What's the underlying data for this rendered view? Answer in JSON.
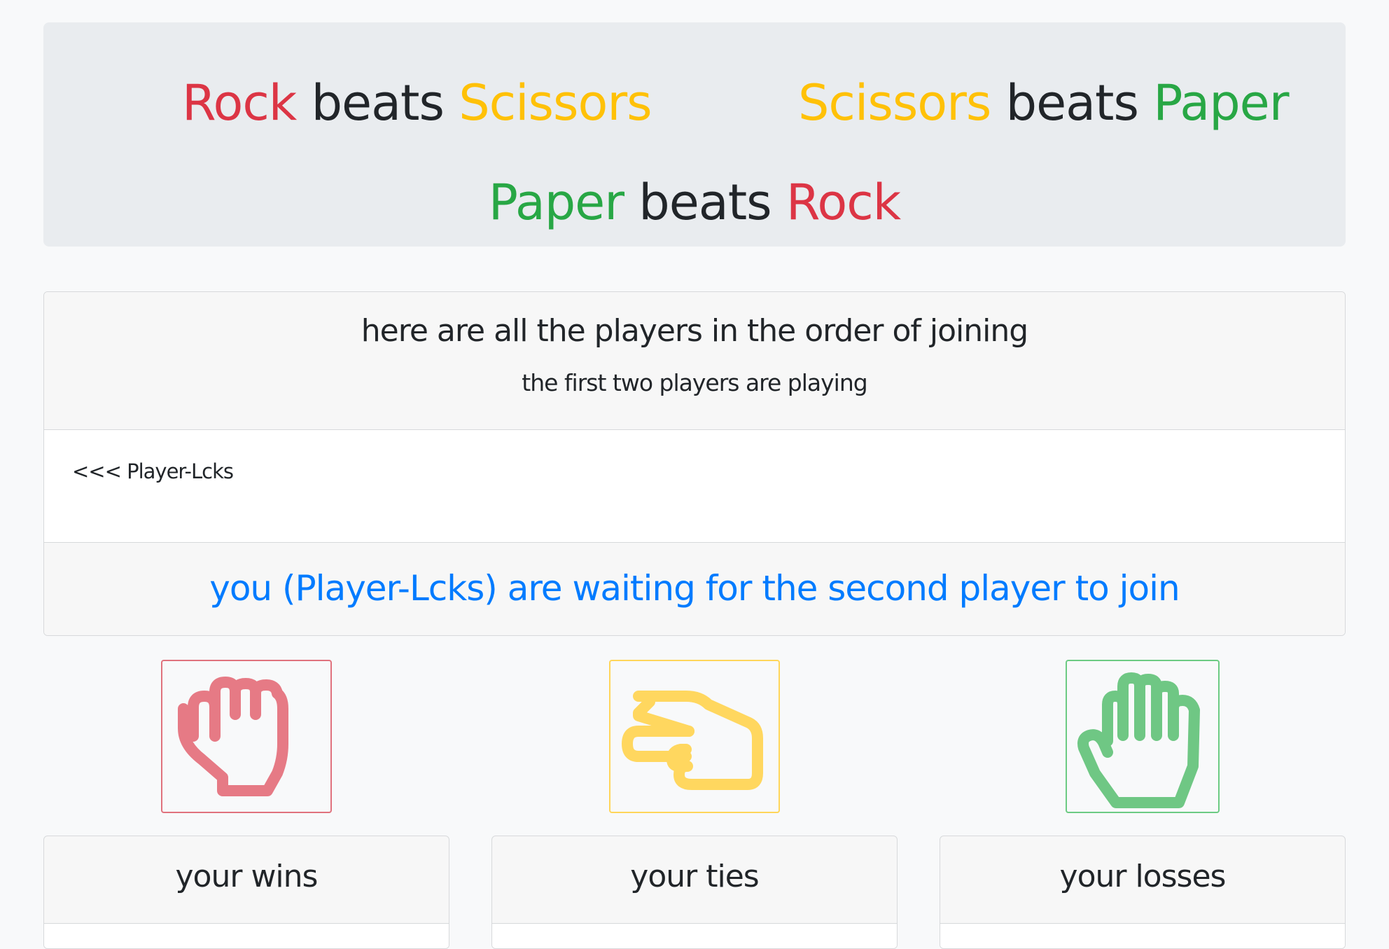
{
  "rules": [
    {
      "winner": "Rock",
      "verb": "beats",
      "loser": "Scissors"
    },
    {
      "winner": "Scissors",
      "verb": "beats",
      "loser": "Paper"
    },
    {
      "winner": "Paper",
      "verb": "beats",
      "loser": "Rock"
    }
  ],
  "colors": {
    "rock": "#dc3545",
    "scissors": "#ffc107",
    "paper": "#28a745",
    "waiting_text": "#007bff"
  },
  "players_panel": {
    "title": "here are all the players in the order of joining",
    "subtitle": "the first two players are playing",
    "players": [
      "<<< Player-Lcks"
    ],
    "status": "you (Player-Lcks) are waiting for the second player to join"
  },
  "choices": [
    {
      "name": "rock",
      "icon": "fist-icon"
    },
    {
      "name": "scissors",
      "icon": "scissors-hand-icon"
    },
    {
      "name": "paper",
      "icon": "open-hand-icon"
    }
  ],
  "stats": {
    "wins_label": "your wins",
    "ties_label": "your ties",
    "losses_label": "your losses"
  }
}
